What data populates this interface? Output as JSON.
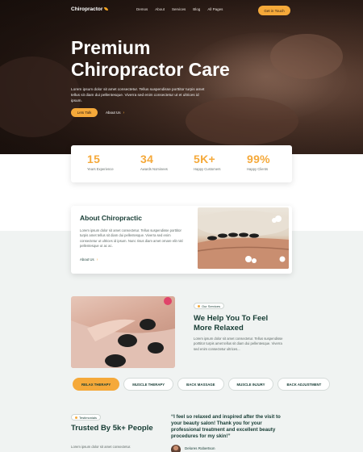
{
  "nav": {
    "logo": "Chiropractor",
    "menu": [
      "Demos",
      "About",
      "Services",
      "Blog",
      "All Pages"
    ],
    "cta": "Get in Touch"
  },
  "hero": {
    "title": "Premium Chiropractor Care",
    "desc": "Lorem ipsum dolor sit amet consectetur. Tellus suspendisse porttitor turpis amet tellus sit diam dui pellentesque. Viverra sed enim consectetur ut et ultrices id ipsum.",
    "btn_talk": "Lets Talk",
    "link_about": "About Us"
  },
  "stats": [
    {
      "num": "15",
      "label": "Years Experience"
    },
    {
      "num": "34",
      "label": "Awards Nominees"
    },
    {
      "num": "5K+",
      "label": "Happy Customers"
    },
    {
      "num": "99%",
      "label": "Happy Clients"
    }
  ],
  "about": {
    "title": "About Chiropractic",
    "text": "Lorem ipsum dolor sit amet consectetur. Tellus suspendisse porttitor turpis amet tellus sit diam dui pellentesque. Viverra sed enim consectetur ut ultrices id ipsum. Nunc risus diam amet ornare elit nisl pellentesque ut ac ac.",
    "link": "About Us"
  },
  "services": {
    "badge": "Our Services",
    "title": "We Help You To Feel More Relaxed",
    "text": "Lorem ipsum dolor sit amet consectetur. Tellus suspendisse porttitor turpis amet tellus sit diam dui pellentesque. Viverra sed enim consectetur ultrices..."
  },
  "tabs": [
    "RELAX THERAPY",
    "MUSCLE THERAPY",
    "BACK MASSAGE",
    "MUSCLE INJURY",
    "BACK ADJUSTMENT"
  ],
  "testimonials": {
    "badge": "Testimonials",
    "title": "Trusted By 5k+ People",
    "text": "Lorem ipsum dolor sit amet consectetur.",
    "quote": "“I feel so relaxed and inspired after the visit to your beauty salon! Thank you for your professional treatment and excellent beauty procedures for my skin!”",
    "author": "Delores Robertson"
  },
  "colors": {
    "accent": "#f5a93a",
    "heading": "#153b33"
  }
}
